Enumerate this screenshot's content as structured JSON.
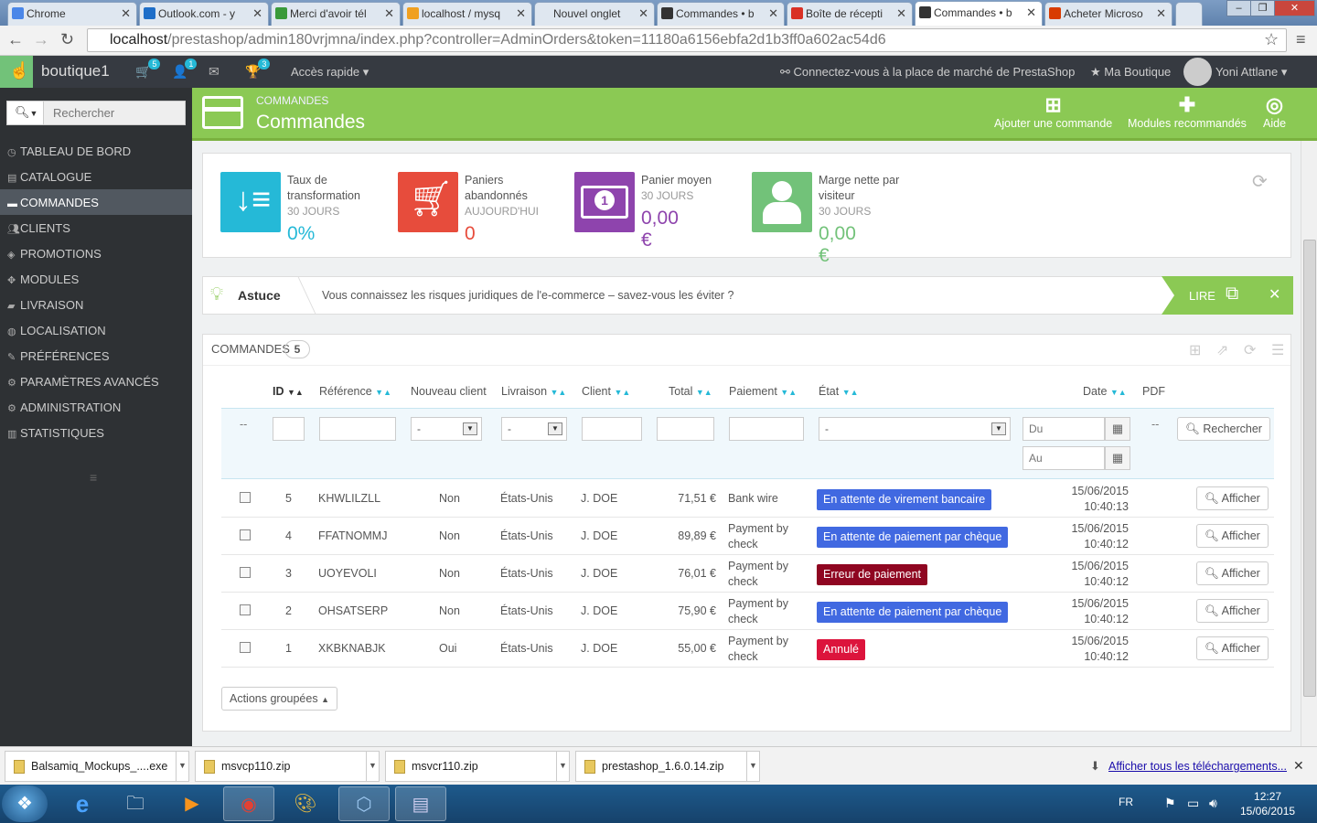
{
  "browser": {
    "tabs": [
      {
        "label": "Chrome",
        "color": "#4a86e8"
      },
      {
        "label": "Outlook.com - y",
        "color": "#1e6ec8"
      },
      {
        "label": "Merci d'avoir tél",
        "color": "#3a9a3a"
      },
      {
        "label": "localhost / mysq",
        "color": "#f0a020"
      },
      {
        "label": "Nouvel onglet",
        "color": ""
      },
      {
        "label": "Commandes • b",
        "color": "#333"
      },
      {
        "label": "Boîte de récepti",
        "color": "#d93025"
      },
      {
        "label": "Commandes • b",
        "color": "#333"
      },
      {
        "label": "Acheter Microso",
        "color": "#d83b01"
      }
    ],
    "url_host": "localhost",
    "url_path": "/prestashop/admin180vrjmna/index.php?controller=AdminOrders&token=11180a6156ebfa2d1b3ff0a602ac54d6"
  },
  "topbar": {
    "shop_name": "boutique1",
    "cart_badge": "5",
    "customers_badge": "1",
    "trophy_badge": "3",
    "quick_access": "Accès rapide",
    "marketplace": "Connectez-vous à la place de marché de PrestaShop",
    "my_shop": "Ma Boutique",
    "user": "Yoni Attlane"
  },
  "sidebar": {
    "search_placeholder": "Rechercher",
    "items": [
      {
        "label": "TABLEAU DE BORD",
        "icon": "dashboard-icon"
      },
      {
        "label": "CATALOGUE",
        "icon": "catalog-icon"
      },
      {
        "label": "COMMANDES",
        "icon": "orders-icon"
      },
      {
        "label": "CLIENTS",
        "icon": "customers-icon"
      },
      {
        "label": "PROMOTIONS",
        "icon": "promotions-icon"
      },
      {
        "label": "MODULES",
        "icon": "modules-icon"
      },
      {
        "label": "LIVRAISON",
        "icon": "shipping-icon"
      },
      {
        "label": "LOCALISATION",
        "icon": "localization-icon"
      },
      {
        "label": "PRÉFÉRENCES",
        "icon": "preferences-icon"
      },
      {
        "label": "PARAMÈTRES AVANCÉS",
        "icon": "advanced-icon"
      },
      {
        "label": "ADMINISTRATION",
        "icon": "admin-icon"
      },
      {
        "label": "STATISTIQUES",
        "icon": "stats-icon"
      }
    ]
  },
  "header": {
    "breadcrumb": "COMMANDES",
    "title": "Commandes",
    "add_order": "Ajouter une commande",
    "recommended_modules": "Modules recommandés",
    "help": "Aide"
  },
  "kpis": [
    {
      "label": "Taux de transformation",
      "period": "30 JOURS",
      "value": "0%",
      "color": "#25b9d7"
    },
    {
      "label": "Paniers abandonnés",
      "period": "AUJOURD'HUI",
      "value": "0",
      "color": "#e74c3c"
    },
    {
      "label": "Panier moyen",
      "period": "30 JOURS",
      "value": "0,00 €",
      "color": "#8e44ad"
    },
    {
      "label": "Marge nette par visiteur",
      "period": "30 JOURS",
      "value": "0,00 €",
      "color": "#72c279"
    }
  ],
  "tip": {
    "title": "Astuce",
    "text": "Vous connaissez les risques juridiques de l'e-commerce – savez-vous les éviter ?",
    "read": "LIRE"
  },
  "orders": {
    "title": "COMMANDES",
    "count": "5",
    "columns": {
      "id": "ID",
      "reference": "Référence",
      "new_client": "Nouveau client",
      "delivery": "Livraison",
      "client": "Client",
      "total": "Total",
      "payment": "Paiement",
      "state": "État",
      "date": "Date",
      "pdf": "PDF"
    },
    "filters": {
      "dash": "--",
      "select_default": "-",
      "date_from": "Du",
      "date_to": "Au",
      "search": "Rechercher"
    },
    "rows": [
      {
        "id": "5",
        "ref": "KHWLILZLL",
        "new": "Non",
        "country": "États-Unis",
        "client": "J. DOE",
        "total": "71,51 €",
        "pay1": "Bank wire",
        "pay2": "",
        "state": "En attente de virement bancaire",
        "state_color": "#4169e1",
        "date": "15/06/2015",
        "time": "10:40:13"
      },
      {
        "id": "4",
        "ref": "FFATNOMMJ",
        "new": "Non",
        "country": "États-Unis",
        "client": "J. DOE",
        "total": "89,89 €",
        "pay1": "Payment by",
        "pay2": "check",
        "state": "En attente de paiement par chèque",
        "state_color": "#4169e1",
        "date": "15/06/2015",
        "time": "10:40:12"
      },
      {
        "id": "3",
        "ref": "UOYEVOLI",
        "new": "Non",
        "country": "États-Unis",
        "client": "J. DOE",
        "total": "76,01 €",
        "pay1": "Payment by",
        "pay2": "check",
        "state": "Erreur de paiement",
        "state_color": "#8f0621",
        "date": "15/06/2015",
        "time": "10:40:12"
      },
      {
        "id": "2",
        "ref": "OHSATSERP",
        "new": "Non",
        "country": "États-Unis",
        "client": "J. DOE",
        "total": "75,90 €",
        "pay1": "Payment by",
        "pay2": "check",
        "state": "En attente de paiement par chèque",
        "state_color": "#4169e1",
        "date": "15/06/2015",
        "time": "10:40:12"
      },
      {
        "id": "1",
        "ref": "XKBKNABJK",
        "new": "Oui",
        "country": "États-Unis",
        "client": "J. DOE",
        "total": "55,00 €",
        "pay1": "Payment by",
        "pay2": "check",
        "state": "Annulé",
        "state_color": "#dc143c",
        "date": "15/06/2015",
        "time": "10:40:12"
      }
    ],
    "view_label": "Afficher",
    "bulk_actions": "Actions groupées"
  },
  "downloads": {
    "items": [
      "Balsamiq_Mockups_....exe",
      "msvcp110.zip",
      "msvcr110.zip",
      "prestashop_1.6.0.14.zip"
    ],
    "show_all": "Afficher tous les téléchargements..."
  },
  "taskbar": {
    "lang": "FR",
    "time": "12:27",
    "date": "15/06/2015"
  }
}
